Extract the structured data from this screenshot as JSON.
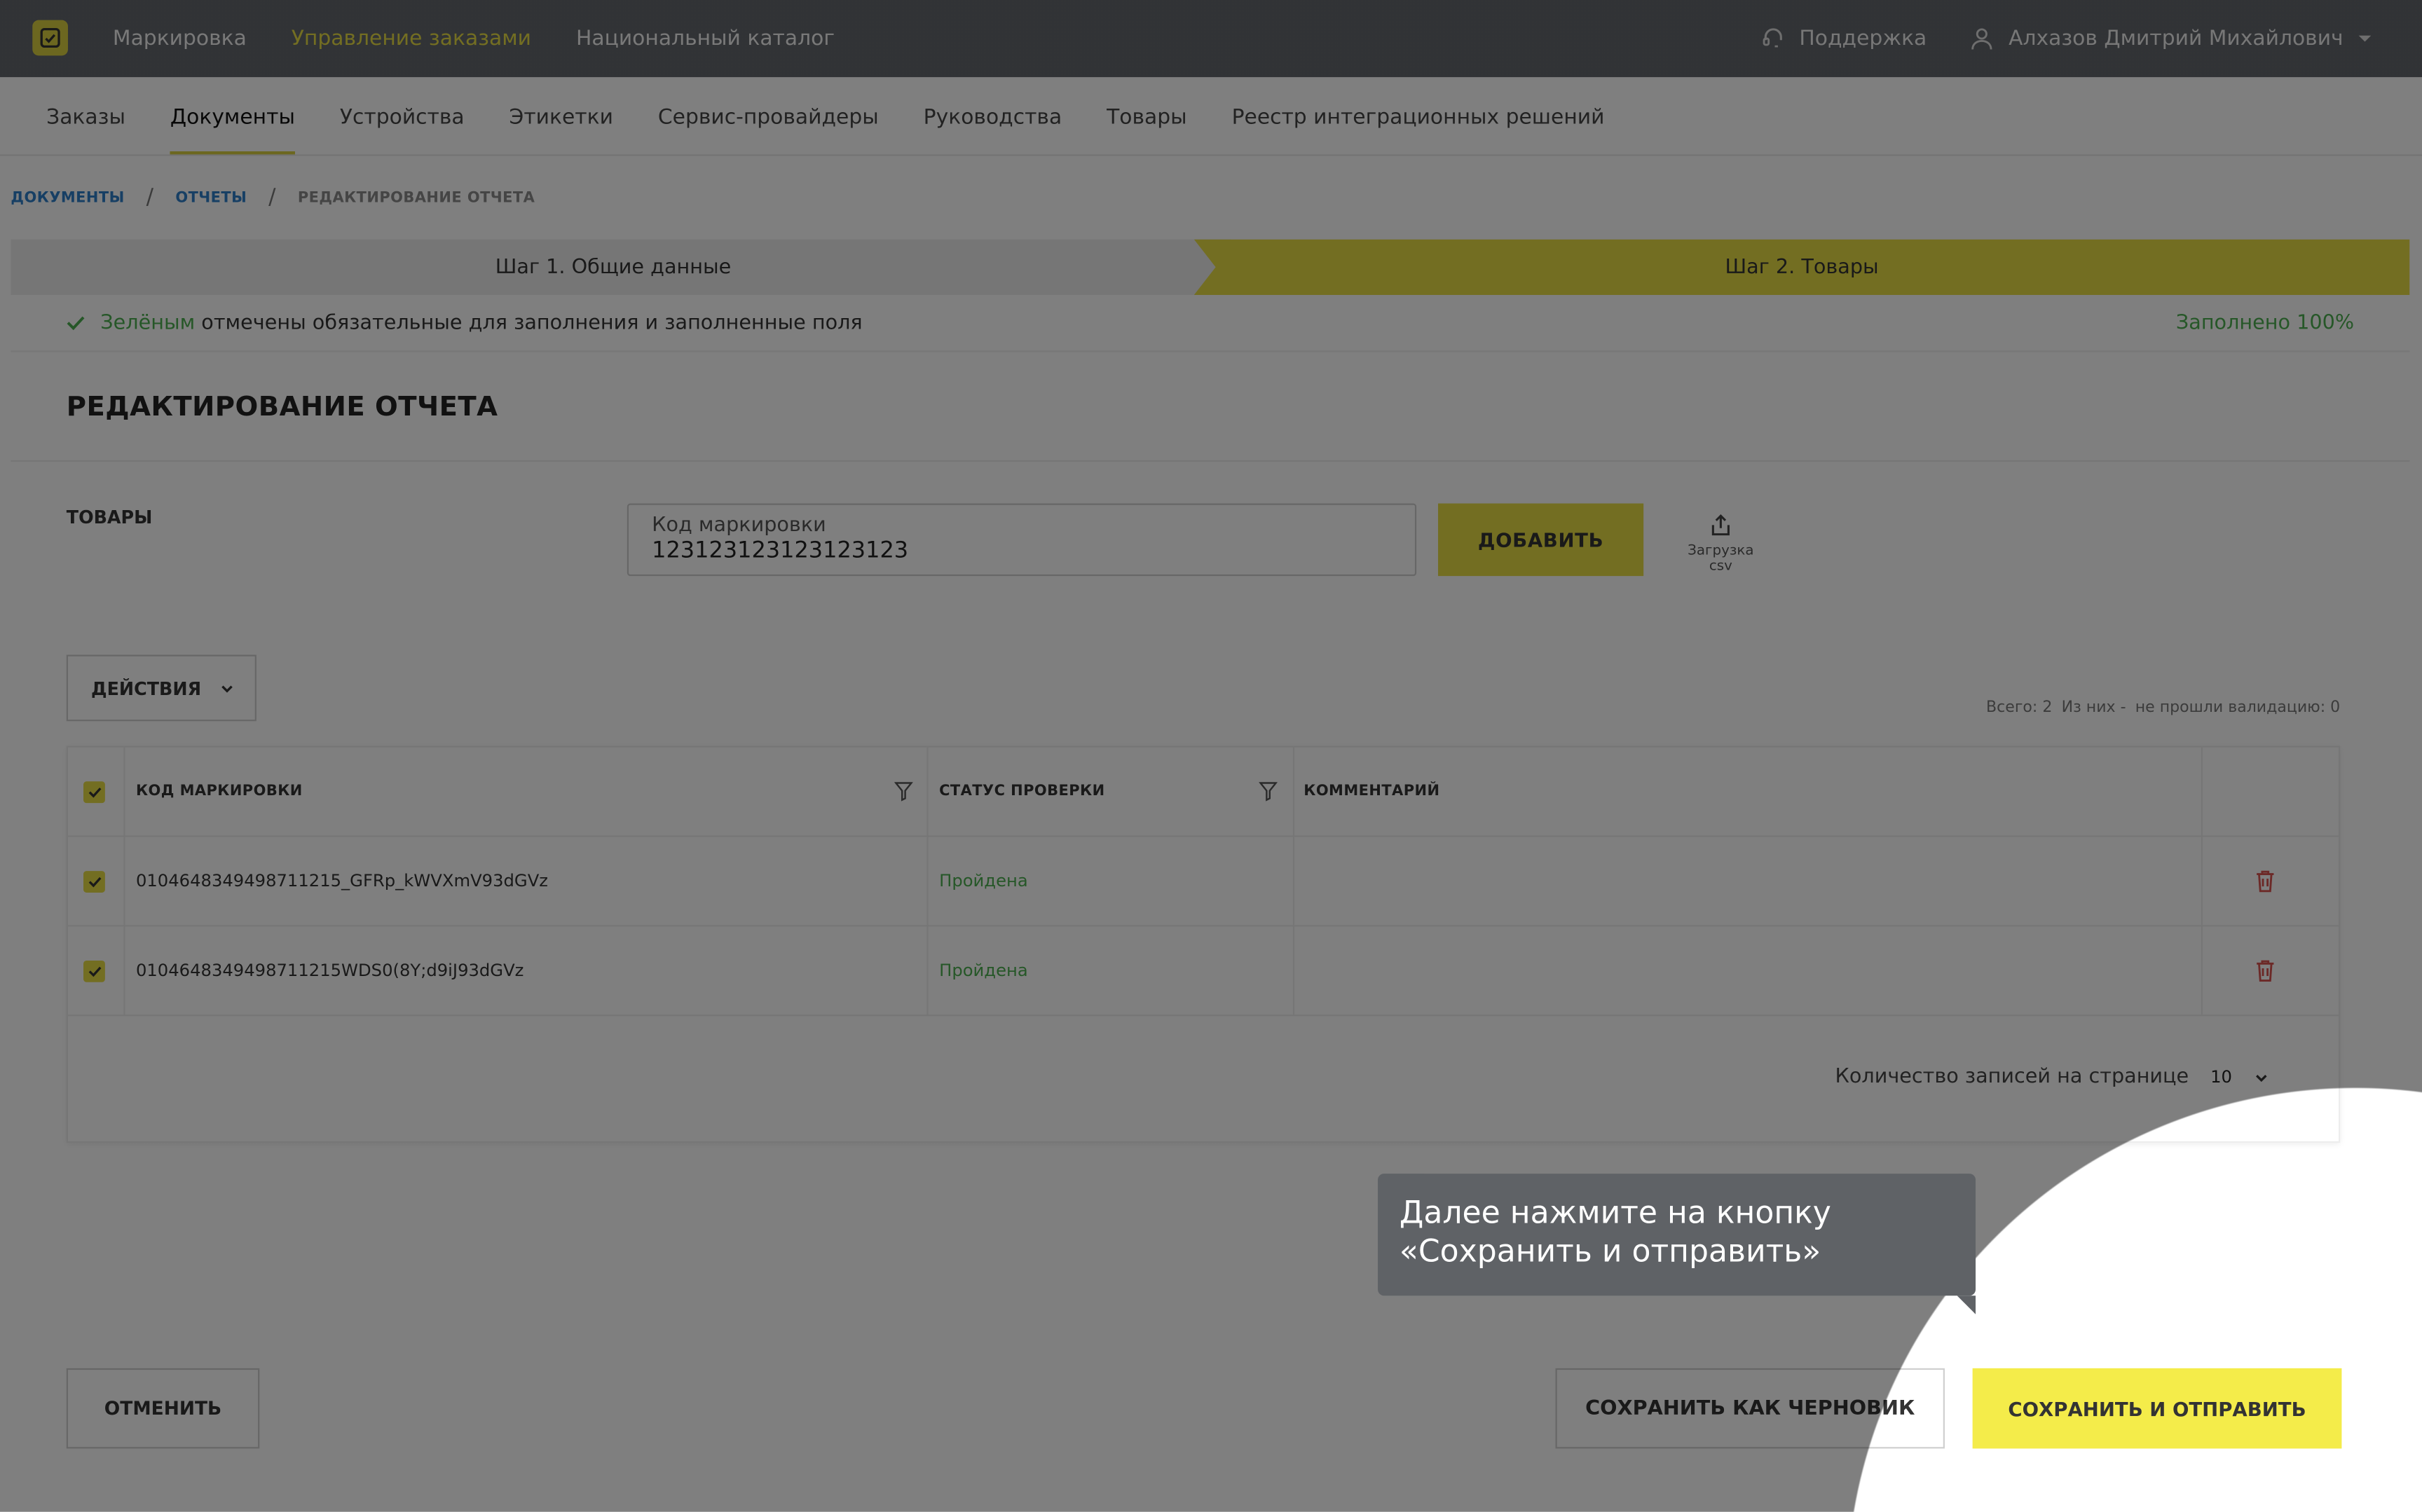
{
  "topnav": {
    "items": [
      "Маркировка",
      "Управление заказами",
      "Национальный каталог"
    ],
    "support": "Поддержка",
    "user": "Алхазов Дмитрий Михайлович"
  },
  "subnav": {
    "tabs": [
      "Заказы",
      "Документы",
      "Устройства",
      "Этикетки",
      "Сервис-провайдеры",
      "Руководства",
      "Товары",
      "Реестр интеграционных решений"
    ],
    "active": "Документы"
  },
  "breadcrumb": [
    "Документы",
    "Отчеты",
    "Редактирование отчета"
  ],
  "steps": {
    "step1": "Шаг 1. Общие данные",
    "step2": "Шаг 2. Товары"
  },
  "hint": {
    "green_word": "Зелёным",
    "text": " отмечены обязательные для заполнения и заполненные поля",
    "filled": "Заполнено 100%"
  },
  "page": {
    "title": "РЕДАКТИРОВАНИЕ ОТЧЕТА",
    "goods_label": "ТОВАРЫ",
    "code_placeholder": "Код маркировки",
    "code_value": "123123123123123123",
    "add_button": "ДОБАВИТЬ",
    "csv_label": "Загрузка csv",
    "actions_button": "ДЕЙСТВИЯ",
    "totals": {
      "total": "Всего: 2",
      "of_them": "Из них -",
      "failed": "не прошли валидацию: 0"
    }
  },
  "table": {
    "headers": {
      "code": "КОД МАРКИРОВКИ",
      "status": "СТАТУС ПРОВЕРКИ",
      "comment": "КОММЕНТАРИЙ"
    },
    "rows": [
      {
        "code": "0104648349498711215_GFRp_kWVXmV93dGVz",
        "status": "Пройдена",
        "comment": ""
      },
      {
        "code": "0104648349498711215WDS0(8Y;d9iJ93dGVz",
        "status": "Пройдена",
        "comment": ""
      }
    ],
    "per_page_label": "Количество записей на странице",
    "per_page_value": "10"
  },
  "buttons": {
    "cancel": "ОТМЕНИТЬ",
    "draft": "СОХРАНИТЬ КАК ЧЕРНОВИК",
    "send": "СОХРАНИТЬ И ОТПРАВИТЬ"
  },
  "tooltip": {
    "line1": "Далее нажмите на кнопку",
    "line2": "«Сохранить и отправить»"
  },
  "colors": {
    "accent": "#e6dc45",
    "success": "#4caf50",
    "link": "#2e7fc9",
    "topbar": "#2f3338"
  }
}
